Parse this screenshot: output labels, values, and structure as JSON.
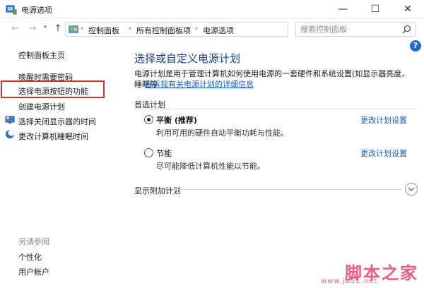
{
  "window": {
    "title": "电源选项",
    "min_glyph": "—",
    "max_glyph": "☐",
    "close_glyph": "✕"
  },
  "nav": {
    "back": "←",
    "forward": "→",
    "dropdown": "▾",
    "up": "↑",
    "breadcrumbs": [
      "控制面板",
      "所有控制面板项",
      "电源选项"
    ],
    "separator": "›",
    "refresh": "↻",
    "search_placeholder": "搜索控制面板"
  },
  "help": "?",
  "sidebar": {
    "home": "控制面板主页",
    "items": [
      "唤醒时需要密码",
      "选择电源按钮的功能",
      "创建电源计划",
      "选择关闭显示器的时间",
      "更改计算机睡眠时间"
    ],
    "see_also_title": "另请参阅",
    "see_also": [
      "个性化",
      "用户帐户"
    ]
  },
  "main": {
    "title": "选择或自定义电源计划",
    "description": "电源计划是用于管理计算机如何使用电源的一套硬件和系统设置(如显示器亮度、睡眠等",
    "description_link": "告诉我有关电源计划的详细信息",
    "preferred_label": "首选计划",
    "plans": [
      {
        "name": "平衡 (推荐)",
        "desc": "利用可用的硬件自动平衡功耗与性能。",
        "link": "更改计划设置",
        "selected": true
      },
      {
        "name": "节能",
        "desc": "尽可能降低计算机性能以节能。",
        "link": "更改计划设置",
        "selected": false
      }
    ],
    "extra_label": "显示附加计划",
    "expand_glyph": "⌄"
  },
  "watermark": {
    "text": "脚本之家",
    "sub": "www.jb51.net"
  },
  "colors": {
    "accent": "#1b3f8f",
    "link": "#1a5fc6",
    "highlight": "#c0392b"
  }
}
